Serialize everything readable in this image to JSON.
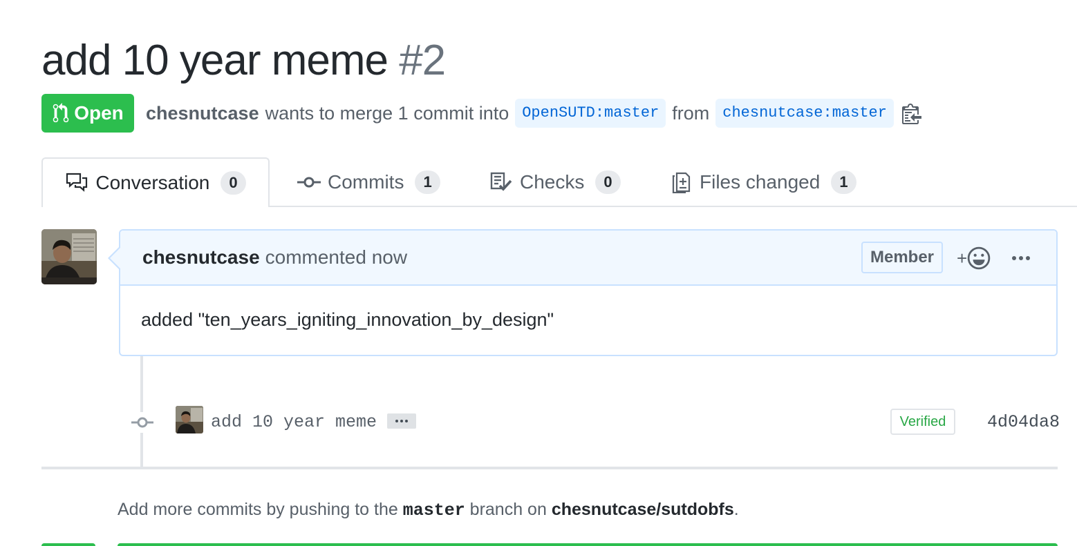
{
  "pr": {
    "title": "add 10 year meme",
    "number": "#2",
    "state": "Open",
    "author": "chesnutcase",
    "merge_text": "wants to merge 1 commit into",
    "base_branch": "OpenSUTD:master",
    "from_text": "from",
    "head_branch": "chesnutcase:master"
  },
  "tabs": [
    {
      "label": "Conversation",
      "count": "0",
      "icon": "comment-discussion-icon",
      "selected": true
    },
    {
      "label": "Commits",
      "count": "1",
      "icon": "git-commit-icon",
      "selected": false
    },
    {
      "label": "Checks",
      "count": "0",
      "icon": "checklist-icon",
      "selected": false
    },
    {
      "label": "Files changed",
      "count": "1",
      "icon": "file-diff-icon",
      "selected": false
    }
  ],
  "comment": {
    "author": "chesnutcase",
    "action": "commented now",
    "role": "Member",
    "reaction_plus": "+",
    "body": "added \"ten_years_igniting_innovation_by_design\""
  },
  "commit": {
    "message": "add 10 year meme",
    "verified": "Verified",
    "sha": "4d04da8"
  },
  "footer": {
    "prefix": "Add more commits by pushing to the",
    "branch": "master",
    "middle": "branch on",
    "repo": "chesnutcase/sutdobfs",
    "suffix": "."
  },
  "colors": {
    "open_green": "#2cbe4e",
    "link_blue": "#0366d6",
    "verified_green": "#28a745"
  }
}
